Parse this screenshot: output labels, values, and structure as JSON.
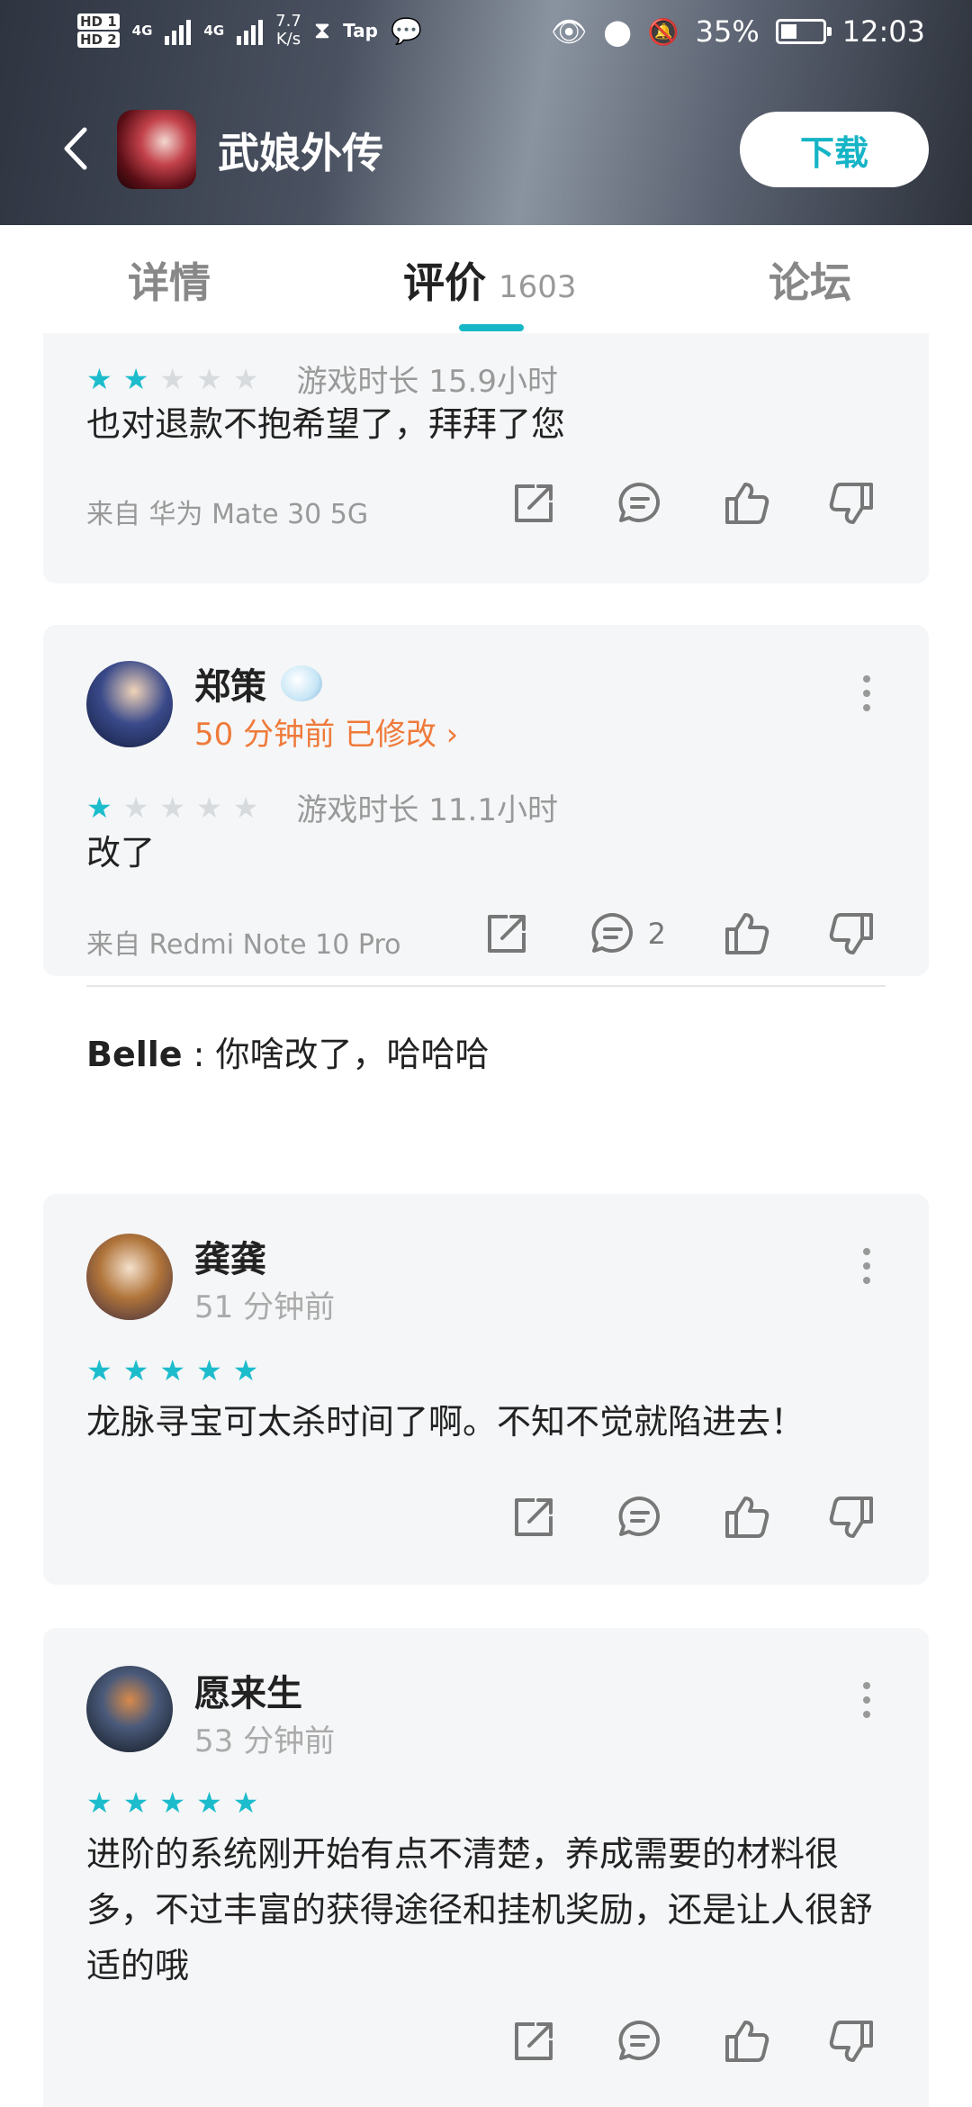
{
  "status_bar": {
    "hd1": "HD 1",
    "hd2": "HD 2",
    "net1": "4G",
    "net2": "4G",
    "speed_value": "7.7",
    "speed_unit": "K/s",
    "tap_label": "Tap",
    "battery": "35%",
    "time": "12:03"
  },
  "header": {
    "app_title": "武娘外传",
    "download_label": "下载"
  },
  "tabs": [
    {
      "label": "详情",
      "count": ""
    },
    {
      "label": "评价",
      "count": "1603"
    },
    {
      "label": "论坛",
      "count": ""
    }
  ],
  "colors": {
    "accent": "#18b7c8",
    "star_on": "#1cbccc",
    "edited": "#ef7a3a"
  },
  "reviews": [
    {
      "stars": 2,
      "playtime": "游戏时长 15.9小时",
      "text": "也对退款不抱希望了，拜拜了您",
      "device": "来自 华为 Mate 30 5G"
    },
    {
      "user": "郑策",
      "time": "50 分钟前 已修改 ›",
      "stars": 1,
      "playtime": "游戏时长 11.1小时",
      "text": "改了",
      "device": "来自 Redmi Note 10 Pro",
      "comment_count": "2",
      "reply_user": "Belle",
      "reply_text": " : 你啥改了，哈哈哈"
    },
    {
      "user": "龚龚",
      "time": "51 分钟前",
      "stars": 5,
      "text": "龙脉寻宝可太杀时间了啊。不知不觉就陷进去！"
    },
    {
      "user": "愿来生",
      "time": "53 分钟前",
      "stars": 5,
      "text": "进阶的系统刚开始有点不清楚，养成需要的材料很多，不过丰富的获得途径和挂机奖励，还是让人很舒适的哦"
    }
  ]
}
